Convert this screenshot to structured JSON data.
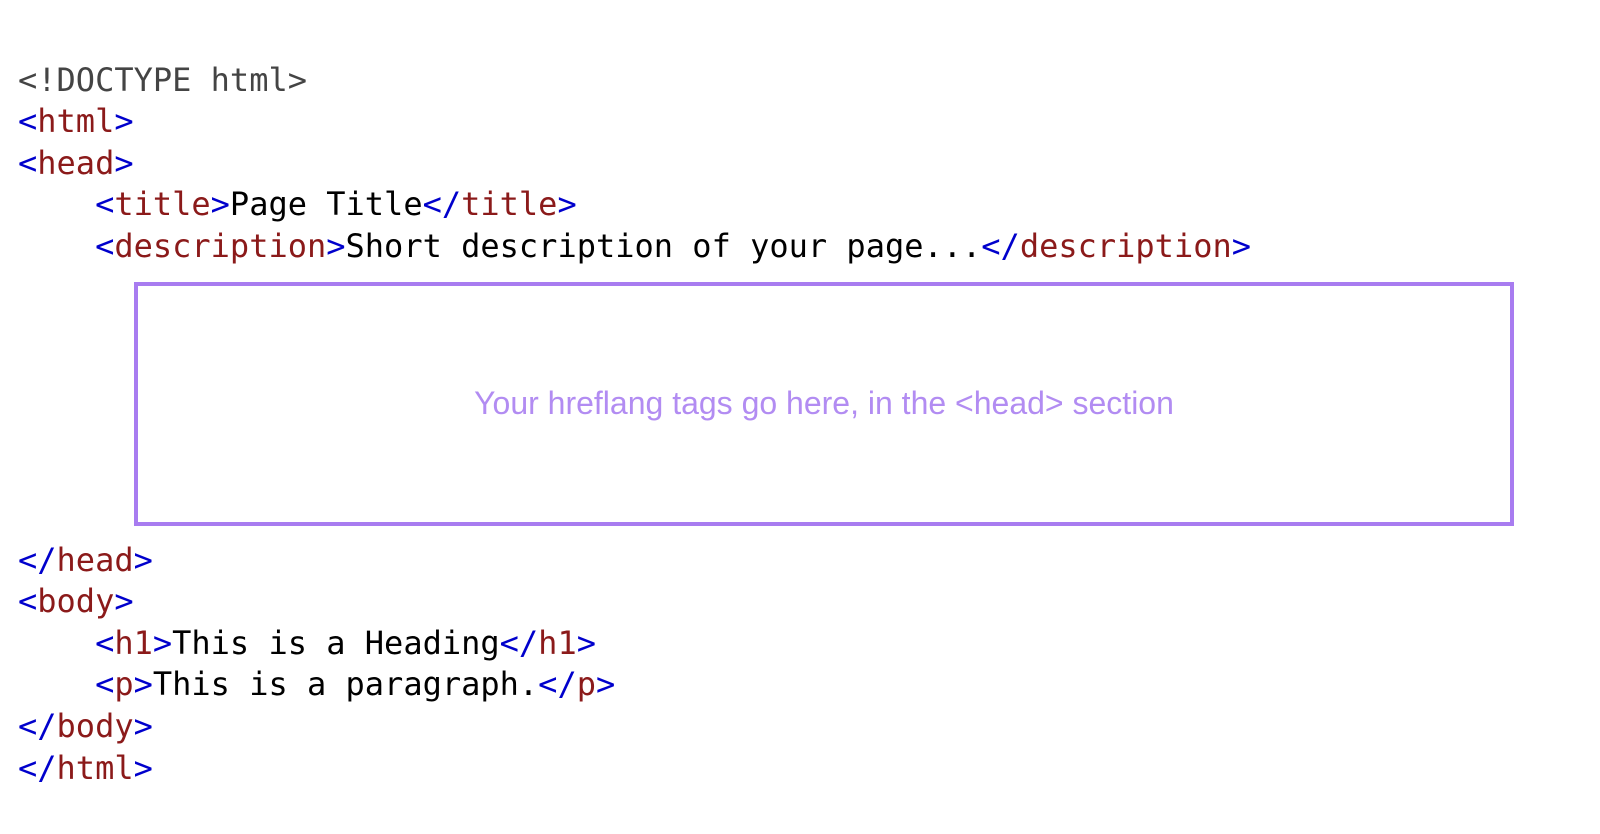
{
  "code": {
    "doctype": "<!DOCTYPE html>",
    "html_open": "html",
    "head_open": "head",
    "title_tag": "title",
    "title_text": "Page Title",
    "description_tag": "description",
    "description_text": "Short description of your page...",
    "head_close": "head",
    "body_open": "body",
    "h1_tag": "h1",
    "h1_text": "This is a Heading",
    "p_tag": "p",
    "p_text": "This is a paragraph.",
    "body_close": "body",
    "html_close": "html"
  },
  "callout": {
    "text": "Your hreflang tags go here, in the <head> section"
  }
}
